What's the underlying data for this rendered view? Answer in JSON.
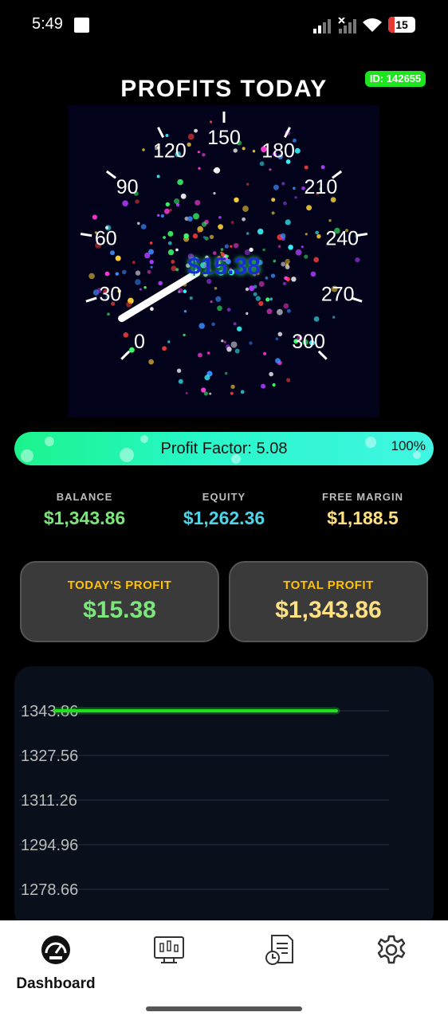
{
  "status_bar": {
    "time": "5:49",
    "battery": "15"
  },
  "header": {
    "title": "PROFITS TODAY",
    "account_id": "ID: 142655"
  },
  "gauge": {
    "ticks": [
      "0",
      "30",
      "60",
      "90",
      "120",
      "150",
      "180",
      "210",
      "240",
      "270",
      "300"
    ],
    "value_text": "$15.38",
    "value": 15.38
  },
  "profit_factor": {
    "label": "Profit Factor: 5.08",
    "percent_text": "100%",
    "fill_fraction": 1.0
  },
  "stats": {
    "balance": {
      "label": "BALANCE",
      "value": "$1,343.86",
      "color": "#7CE67C"
    },
    "equity": {
      "label": "EQUITY",
      "value": "$1,262.36",
      "color": "#4DD4E8"
    },
    "free_margin": {
      "label": "FREE MARGIN",
      "value": "$1,188.5",
      "color": "#FFE082"
    }
  },
  "cards": {
    "today": {
      "label": "TODAY'S PROFIT",
      "value": "$15.38",
      "color": "#7CE67C"
    },
    "total": {
      "label": "TOTAL PROFIT",
      "value": "$1,343.86",
      "color": "#FFE082"
    }
  },
  "chart_data": {
    "type": "line",
    "y_ticks": [
      "1343.86",
      "1327.56",
      "1311.26",
      "1294.96",
      "1278.66"
    ],
    "series": [
      {
        "values": [
          1343.86,
          1343.86
        ]
      }
    ],
    "line_color": "#22dd22"
  },
  "nav": {
    "items": [
      {
        "label": "Dashboard",
        "icon": "speedometer-icon",
        "active": true
      },
      {
        "label": "",
        "icon": "candlestick-chart-icon"
      },
      {
        "label": "",
        "icon": "report-history-icon"
      },
      {
        "label": "",
        "icon": "gear-icon"
      }
    ]
  }
}
